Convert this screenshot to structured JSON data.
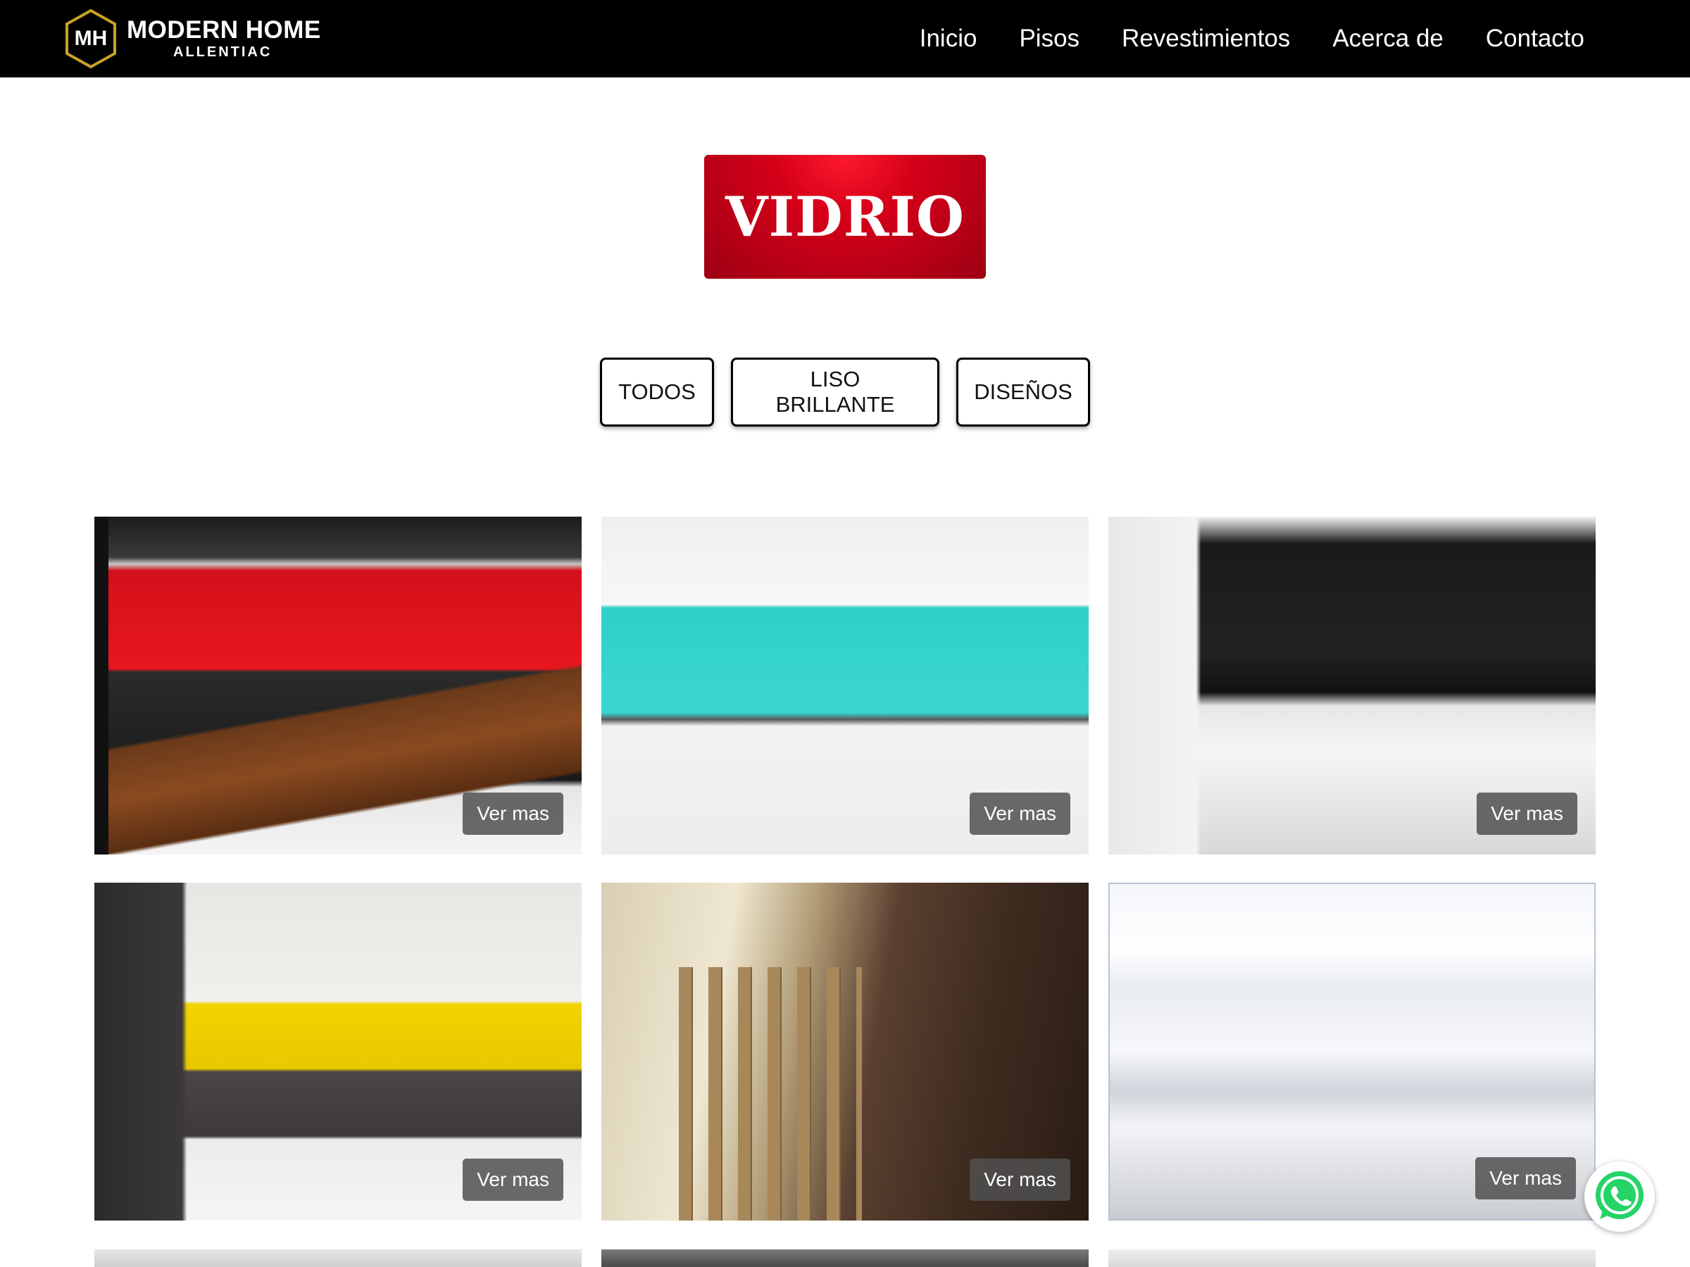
{
  "brand": {
    "initials": "MH",
    "name": "MODERN HOME",
    "tagline": "ALLENTIAC",
    "accent": "#c9a227"
  },
  "nav": {
    "items": [
      {
        "label": "Inicio"
      },
      {
        "label": "Pisos"
      },
      {
        "label": "Revestimientos"
      },
      {
        "label": "Acerca de"
      },
      {
        "label": "Contacto"
      }
    ]
  },
  "hero": {
    "title": "VIDRIO",
    "color": "#c8001a"
  },
  "filters": [
    {
      "label": "TODOS"
    },
    {
      "label": "LISO BRILLANTE"
    },
    {
      "label": "DISEÑOS"
    }
  ],
  "gallery": [
    {
      "name": "kitchen-red-glass",
      "button": "Ver mas"
    },
    {
      "name": "kitchen-turquoise-glass",
      "button": "Ver mas"
    },
    {
      "name": "kitchen-black-glass",
      "button": "Ver mas"
    },
    {
      "name": "kitchen-yellow-glass",
      "button": "Ver mas"
    },
    {
      "name": "kitchen-bronze-glass",
      "button": "Ver mas"
    },
    {
      "name": "kitchen-white-glass",
      "button": "Ver mas"
    }
  ],
  "whatsapp": {
    "icon": "whatsapp-icon",
    "color": "#25d366"
  }
}
